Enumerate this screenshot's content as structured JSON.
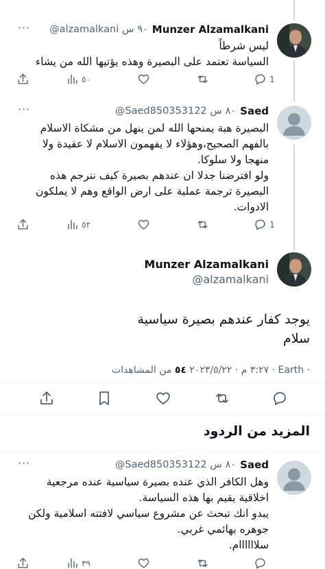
{
  "tweet1": {
    "name": "Munzer Alzamalkani",
    "handle_time": "@alzamalkani ٩٠ س",
    "more": "···",
    "text": "ليس شرطاً\nالسياسة تعتمد على البصيرة وهذه يؤتيها الله من يشاء",
    "views": "٥٠"
  },
  "tweet2": {
    "name": "Saed",
    "handle_time": "@Saed850353122 ٨٠ س",
    "more": "···",
    "text": "البصيرة هبة يمنحها الله لمن ينهل من مشكاة الاسلام بالفهم الصحيح،وهؤلاء لا يفهمون الاسلام لا عقيدة ولا منهجا ولا سلوكا.\nولو افترضنا جدلا ان عندهم بصيرة كيف نترجم هذه البصيرة ترجمة عملية على ارض الواقع وهم لا يملكون الادوات.",
    "views": "٥٢"
  },
  "main_tweet": {
    "name": "Munzer Alzamalkani",
    "handle": "@alzamalkani",
    "text": "يوجد كفار عندهم بصيرة سياسية\nسلام",
    "meta_date": "٣:٢٧ م · ٢٠٢٣/٥/٢٢ · Earth ·",
    "meta_views_count": "٥٤",
    "meta_views_label": "من المشاهدات"
  },
  "more_replies_title": "المزيد من الردود",
  "tweet3": {
    "name": "Saed",
    "handle_time": "@Saed850353122 ٨٠ س",
    "more": "···",
    "text": "وهل الكافر الذي عنده بصيرة سياسية عنده مرجعية اخلاقية يقيم بها هذه السياسة.\nيبدو انك تبحث عن مشروع سياسي لافتته اسلامية ولكن جوهره بهائمي غربي.\nسلاااااام.",
    "views": "٣٩"
  },
  "icons": [
    "reply-icon",
    "retweet-icon",
    "like-icon",
    "views-icon",
    "share-icon",
    "bookmark-icon"
  ],
  "colors": {
    "text": "#0f1419",
    "secondary": "#536471",
    "divider": "#eff3f4",
    "thread": "#cfd9de"
  }
}
